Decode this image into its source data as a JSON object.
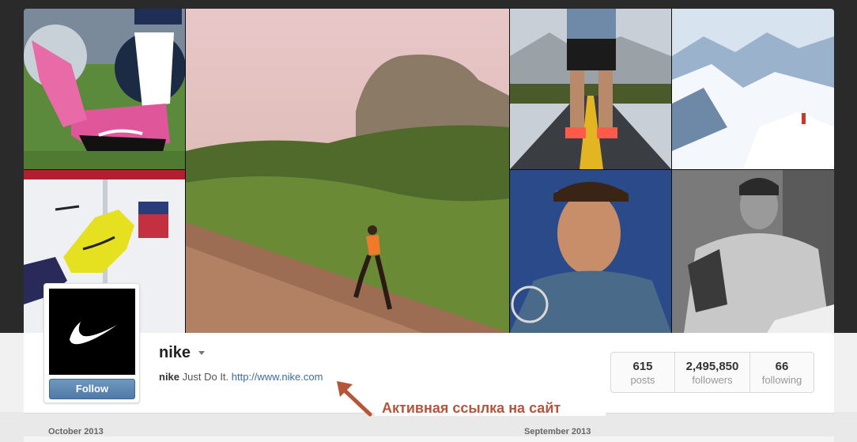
{
  "profile": {
    "username": "nike",
    "bio_name": "nike",
    "bio_text": "Just Do It.",
    "website": "http://www.nike.com",
    "follow_label": "Follow"
  },
  "stats": [
    {
      "value": "615",
      "label": "posts"
    },
    {
      "value": "2,495,850",
      "label": "followers"
    },
    {
      "value": "66",
      "label": "following"
    }
  ],
  "annotation": {
    "text": "Активная ссылка на сайт"
  },
  "timeline": {
    "month_left": "October 2013",
    "month_right": "September 2013"
  },
  "photos": [
    {
      "subject": "pink-football-cleats-photo"
    },
    {
      "subject": "runner-on-hill-photo"
    },
    {
      "subject": "runner-on-road-photo"
    },
    {
      "subject": "snowy-mountains-photo"
    },
    {
      "subject": "goalkeeper-glove-photo"
    },
    {
      "subject": "tennis-player-photo"
    },
    {
      "subject": "tennis-player-hoodie-photo"
    }
  ],
  "colors": {
    "link": "#3a6c9a",
    "follow_button": "#5a84ad",
    "annotation": "#b5553a"
  }
}
